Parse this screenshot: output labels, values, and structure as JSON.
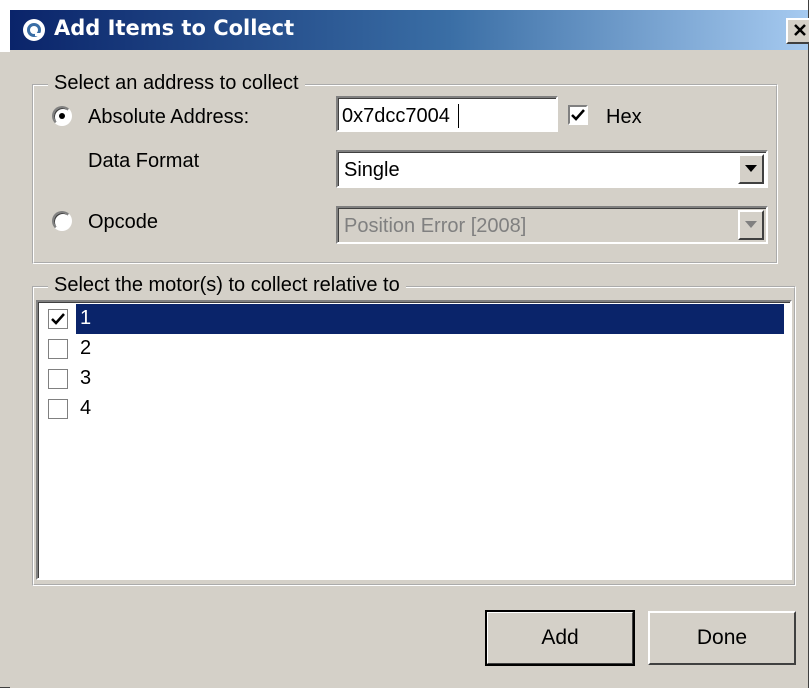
{
  "window": {
    "title": "Add Items to Collect",
    "close_label": "X"
  },
  "address_group": {
    "legend": "Select an address to collect",
    "absolute_label": "Absolute Address:",
    "absolute_selected": true,
    "address_value": "0x7dcc7004",
    "hex_label": "Hex",
    "hex_checked": true,
    "data_format_label": "Data Format",
    "data_format_value": "Single",
    "opcode_label": "Opcode",
    "opcode_selected": false,
    "opcode_value": "Position Error [2008]",
    "opcode_enabled": false
  },
  "motor_group": {
    "legend": "Select the motor(s) to collect relative to",
    "motors": [
      {
        "label": "1",
        "checked": true,
        "selected": true
      },
      {
        "label": "2",
        "checked": false,
        "selected": false
      },
      {
        "label": "3",
        "checked": false,
        "selected": false
      },
      {
        "label": "4",
        "checked": false,
        "selected": false
      }
    ]
  },
  "buttons": {
    "add": "Add",
    "done": "Done"
  },
  "colors": {
    "title_gradient_start": "#0a246a",
    "title_gradient_end": "#a6caf0",
    "selection": "#0a246a",
    "face": "#d4d0c8"
  },
  "icons": {
    "app": "app-logo-icon",
    "close": "close-icon",
    "dropdown": "chevron-down-icon",
    "check": "checkmark-icon"
  }
}
